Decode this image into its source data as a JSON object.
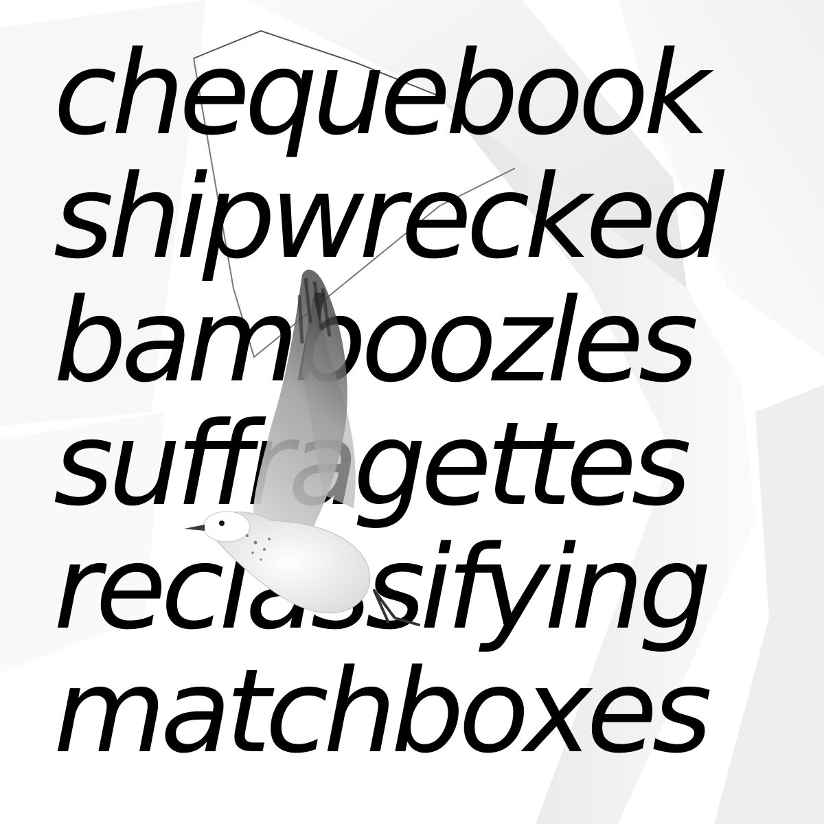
{
  "words": [
    "chequebook",
    "shipwrecked",
    "bamboozles",
    "suffragettes",
    "reclassifying",
    "matchboxes"
  ],
  "colors": {
    "text": "#000000",
    "background": "#ffffff",
    "shape_light": "#f2f2f2",
    "shape_shadow": "#d9d9d9"
  },
  "image": {
    "subject": "seagull-in-flight",
    "style": "monochrome-photo"
  }
}
